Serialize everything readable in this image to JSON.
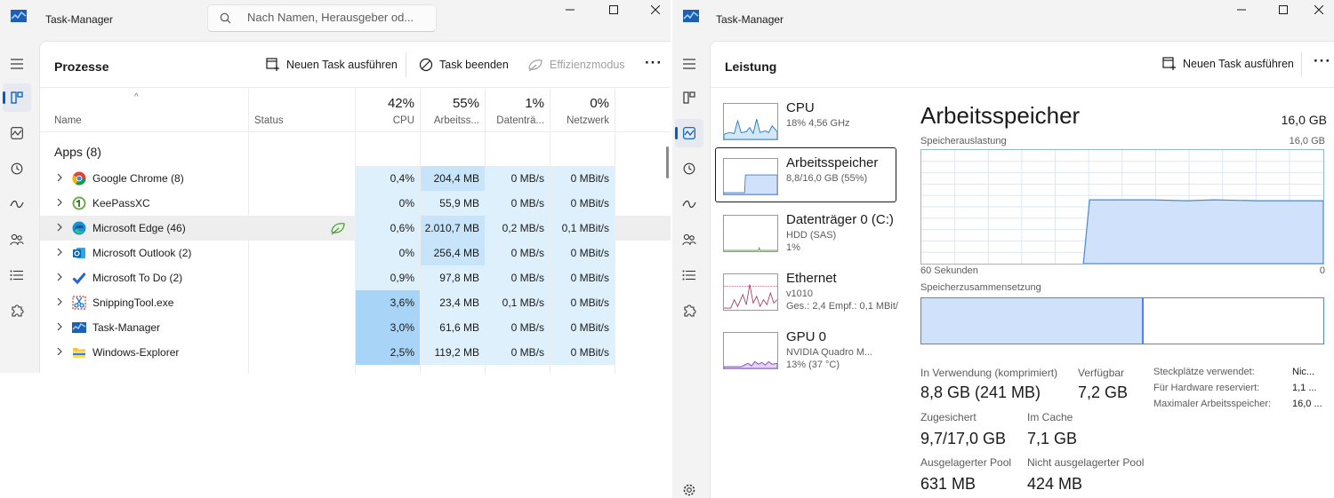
{
  "left": {
    "app_title": "Task-Manager",
    "search_placeholder": "Nach Namen, Herausgeber od...",
    "page_title": "Prozesse",
    "toolbar": {
      "new_task": "Neuen Task ausführen",
      "end_task": "Task beenden",
      "efficiency": "Effizienzmodus"
    },
    "columns": {
      "name": "Name",
      "status": "Status",
      "cpu": {
        "pct": "42%",
        "label": "CPU"
      },
      "mem": {
        "pct": "55%",
        "label": "Arbeitss..."
      },
      "disk": {
        "pct": "1%",
        "label": "Datenträ..."
      },
      "net": {
        "pct": "0%",
        "label": "Netzwerk"
      }
    },
    "group_label": "Apps (8)",
    "rows": [
      {
        "name": "Google Chrome (8)",
        "cpu": "0,4%",
        "mem": "204,4 MB",
        "disk": "0 MB/s",
        "net": "0 MBit/s",
        "icon": "chrome-icon"
      },
      {
        "name": "KeePassXC",
        "cpu": "0%",
        "mem": "55,9 MB",
        "disk": "0 MB/s",
        "net": "0 MBit/s",
        "icon": "keepassxc-icon"
      },
      {
        "name": "Microsoft Edge (46)",
        "cpu": "0,6%",
        "mem": "2.010,7 MB",
        "disk": "0,2 MB/s",
        "net": "0,1 MBit/s",
        "icon": "edge-icon"
      },
      {
        "name": "Microsoft Outlook (2)",
        "cpu": "0%",
        "mem": "256,4 MB",
        "disk": "0 MB/s",
        "net": "0 MBit/s",
        "icon": "outlook-icon"
      },
      {
        "name": "Microsoft To Do (2)",
        "cpu": "0,9%",
        "mem": "97,8 MB",
        "disk": "0 MB/s",
        "net": "0 MBit/s",
        "icon": "todo-icon"
      },
      {
        "name": "SnippingTool.exe",
        "cpu": "3,6%",
        "mem": "23,4 MB",
        "disk": "0,1 MB/s",
        "net": "0 MBit/s",
        "icon": "snipping-tool-icon"
      },
      {
        "name": "Task-Manager",
        "cpu": "3,0%",
        "mem": "61,6 MB",
        "disk": "0 MB/s",
        "net": "0 MBit/s",
        "icon": "task-manager-icon"
      },
      {
        "name": "Windows-Explorer",
        "cpu": "2,5%",
        "mem": "119,2 MB",
        "disk": "0 MB/s",
        "net": "0 MBit/s",
        "icon": "file-explorer-icon"
      }
    ],
    "heat_colors": {
      "light": "#dff0fd",
      "mid": "#c7e4fb",
      "strong": "#a7d4f7"
    }
  },
  "right": {
    "app_title": "Task-Manager",
    "page_title": "Leistung",
    "toolbar": {
      "new_task": "Neuen Task ausführen"
    },
    "perf_items": [
      {
        "title": "CPU",
        "sub1": "18% 4,56 GHz",
        "sub2": "",
        "sub3": ""
      },
      {
        "title": "Arbeitsspeicher",
        "sub1": "8,8/16,0 GB (55%)",
        "sub2": "",
        "sub3": ""
      },
      {
        "title": "Datenträger 0 (C:)",
        "sub1": "HDD (SAS)",
        "sub2": "1%",
        "sub3": ""
      },
      {
        "title": "Ethernet",
        "sub1": "v1010",
        "sub2": "Ges.: 2,4 Empf.: 0,1 MBit/s",
        "sub3": ""
      },
      {
        "title": "GPU 0",
        "sub1": "NVIDIA Quadro M...",
        "sub2": "13% (37 °C)",
        "sub3": ""
      }
    ],
    "memory": {
      "title": "Arbeitsspeicher",
      "total": "16,0 GB",
      "usage_label": "Speicherauslastung",
      "usage_max": "16,0 GB",
      "axis_left": "60 Sekunden",
      "axis_right": "0",
      "composition_label": "Speicherzusammensetzung",
      "stats": {
        "in_use_label": "In Verwendung (komprimiert)",
        "in_use_value": "8,8 GB (241 MB)",
        "available_label": "Verfügbar",
        "available_value": "7,2 GB",
        "committed_label": "Zugesichert",
        "committed_value": "9,7/17,0 GB",
        "cached_label": "Im Cache",
        "cached_value": "7,1 GB",
        "paged_label": "Ausgelagerter Pool",
        "paged_value": "631 MB",
        "nonpaged_label": "Nicht ausgelagerter Pool",
        "nonpaged_value": "424 MB"
      },
      "kv": [
        {
          "label": "Steckplätze verwendet:",
          "value": "Nic..."
        },
        {
          "label": "Für Hardware reserviert:",
          "value": "1,1 ..."
        },
        {
          "label": "Maximaler Arbeitsspeicher:",
          "value": "16,0 ..."
        }
      ]
    }
  }
}
